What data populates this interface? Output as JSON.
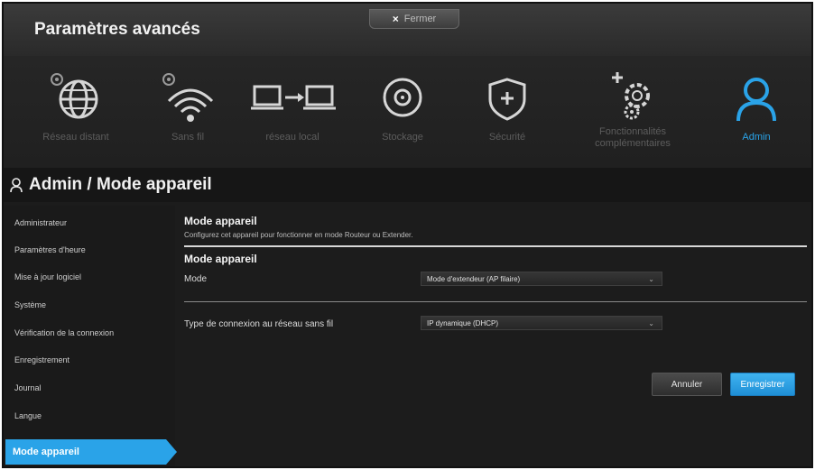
{
  "header": {
    "title": "Paramètres avancés",
    "close_label": "Fermer",
    "close_symbol": "×"
  },
  "nav": {
    "items": [
      {
        "label": "Réseau distant",
        "icon": "globe-icon"
      },
      {
        "label": "Sans fil",
        "icon": "wifi-icon"
      },
      {
        "label": "réseau local",
        "icon": "lan-icon"
      },
      {
        "label": "Stockage",
        "icon": "storage-icon"
      },
      {
        "label": "Sécurité",
        "icon": "shield-icon"
      },
      {
        "label": "Fonctionnalités complémentaires",
        "icon": "gears-icon"
      },
      {
        "label": "Admin",
        "icon": "user-icon",
        "active": true
      }
    ],
    "active_color": "#2aa3e8",
    "inactive_color": "#5d5d5d"
  },
  "breadcrumb": {
    "text": "Admin / Mode appareil",
    "icon": "user-icon"
  },
  "sidebar": {
    "items": [
      {
        "label": "Administrateur"
      },
      {
        "label": "Paramètres d'heure"
      },
      {
        "label": "Mise à jour logiciel"
      },
      {
        "label": "Système"
      },
      {
        "label": "Vérification de la connexion"
      },
      {
        "label": "Enregistrement"
      },
      {
        "label": "Journal"
      },
      {
        "label": "Langue"
      },
      {
        "label": "Mode appareil",
        "active": true
      }
    ]
  },
  "main": {
    "section_title": "Mode appareil",
    "section_desc": "Configurez cet appareil pour fonctionner en mode Routeur ou Extender.",
    "subsection_title": "Mode appareil",
    "mode_label": "Mode",
    "mode_value": "Mode d'extendeur (AP filaire)",
    "conn_label": "Type de connexion au réseau sans fil",
    "conn_value": "IP dynamique (DHCP)",
    "dropdown_arrow": "⌄",
    "cancel_label": "Annuler",
    "save_label": "Enregistrer"
  },
  "colors": {
    "accent": "#2aa3e8",
    "background": "#1c1c1c"
  }
}
